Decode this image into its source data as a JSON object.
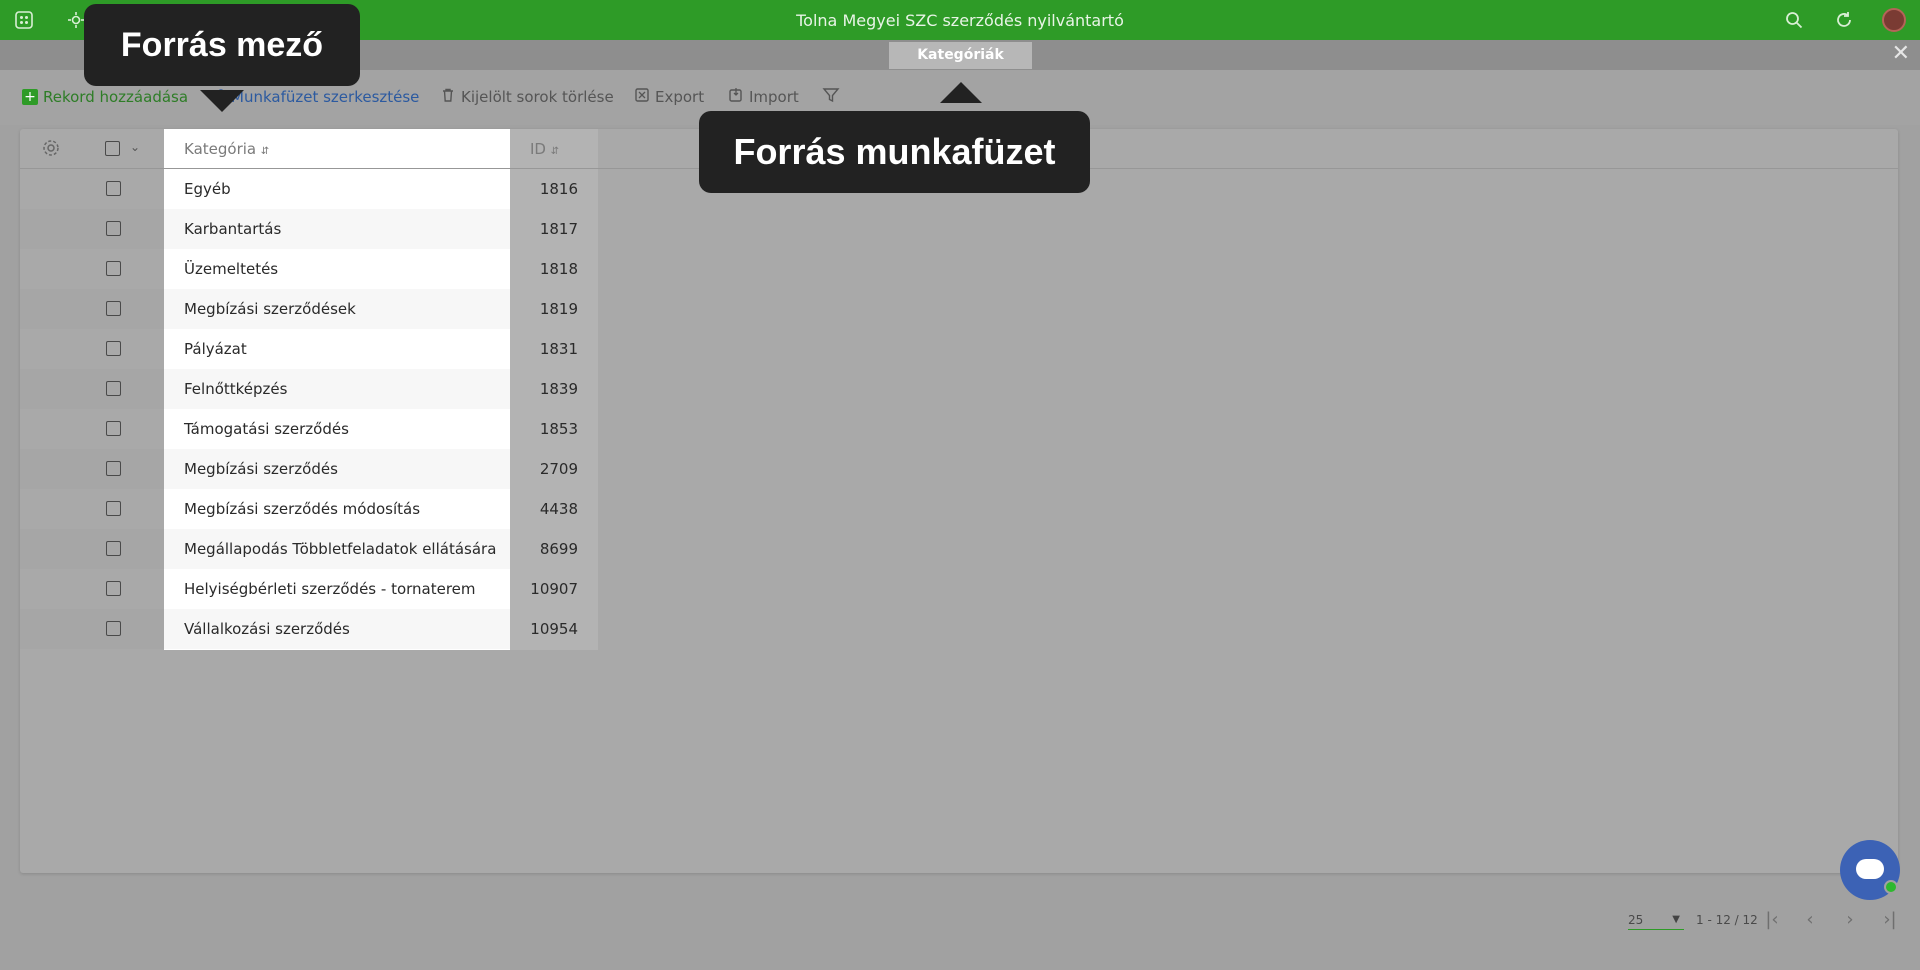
{
  "app": {
    "title": "Tolna Megyei SZC szerződés nyilvántartó",
    "tab_label": "Kategóriák",
    "close_glyph": "✕"
  },
  "toolbar": {
    "add_label": "Rekord hozzáadása",
    "edit_label": "Munkafüzet szerkesztése",
    "delete_label": "Kijelölt sorok törlése",
    "export_label": "Export",
    "import_label": "Import"
  },
  "table": {
    "columns": [
      "Kategória",
      "ID"
    ],
    "rows": [
      {
        "category": "Egyéb",
        "id": "1816"
      },
      {
        "category": "Karbantartás",
        "id": "1817"
      },
      {
        "category": "Üzemeltetés",
        "id": "1818"
      },
      {
        "category": "Megbízási szerződések",
        "id": "1819"
      },
      {
        "category": "Pályázat",
        "id": "1831"
      },
      {
        "category": "Felnőttképzés",
        "id": "1839"
      },
      {
        "category": "Támogatási szerződés",
        "id": "1853"
      },
      {
        "category": "Megbízási szerződés",
        "id": "2709"
      },
      {
        "category": "Megbízási szerződés módosítás",
        "id": "4438"
      },
      {
        "category": "Megállapodás Többletfeladatok ellátására",
        "id": "8699"
      },
      {
        "category": "Helyiségbérleti szerződés - tornaterem",
        "id": "10907"
      },
      {
        "category": "Vállalkozási szerződés",
        "id": "10954"
      }
    ]
  },
  "tooltips": {
    "field": "Forrás mező",
    "workbook": "Forrás munkafüzet"
  },
  "pagination": {
    "page_size": "25",
    "range": "1 - 12 / 12"
  },
  "colors": {
    "brand": "#2e9b27",
    "tooltip": "#222222",
    "chat": "#3c62b5"
  },
  "icons": [
    "apps-icon",
    "settings-icon",
    "search-icon",
    "refresh-icon",
    "close-icon",
    "plus-icon",
    "link-icon",
    "trash-icon",
    "export-icon",
    "import-icon",
    "filter-icon",
    "gear-icon",
    "sort-icon",
    "chat-icon"
  ]
}
